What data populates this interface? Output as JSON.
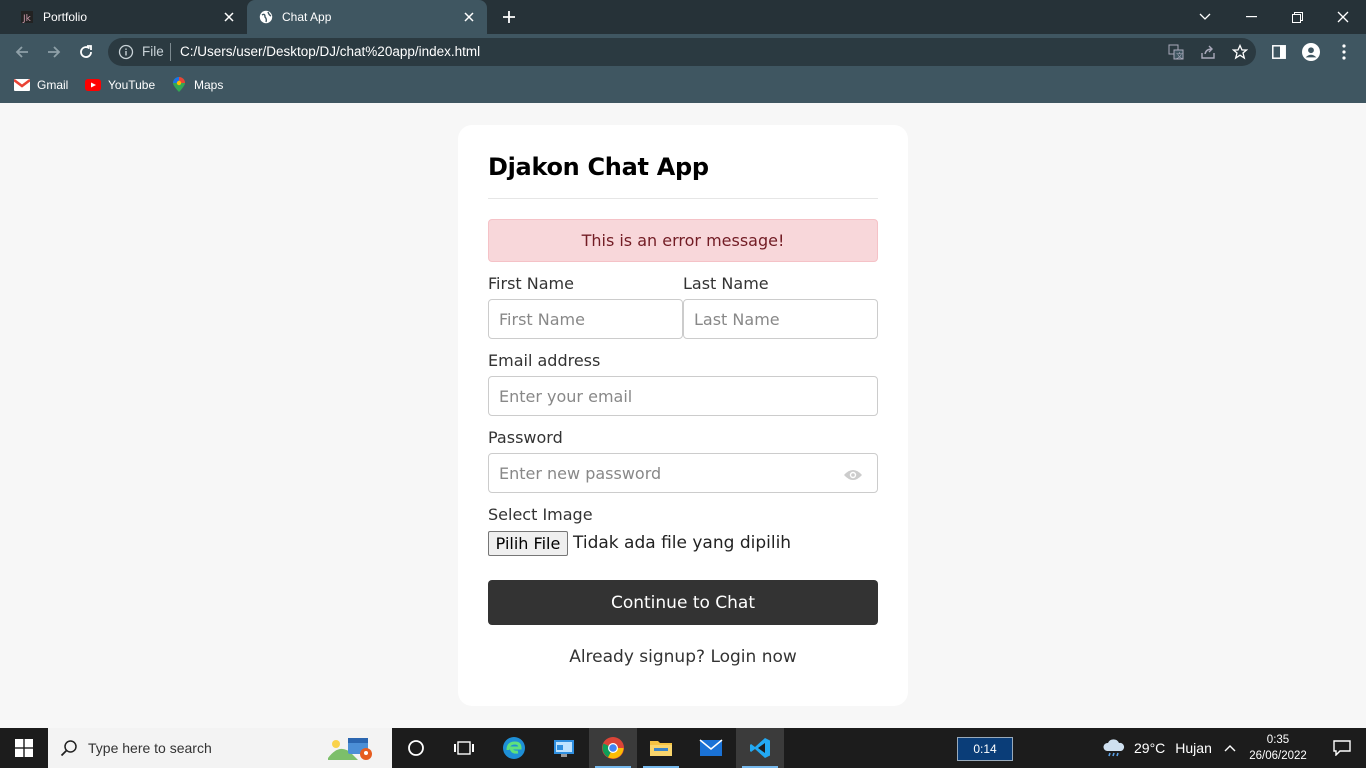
{
  "browser": {
    "tabs": [
      {
        "title": "Portfolio",
        "active": false
      },
      {
        "title": "Chat App",
        "active": true
      }
    ],
    "address": {
      "scheme_label": "File",
      "url": "C:/Users/user/Desktop/DJ/chat%20app/index.html"
    },
    "bookmarks": [
      {
        "label": "Gmail",
        "icon": "gmail-icon"
      },
      {
        "label": "YouTube",
        "icon": "youtube-icon"
      },
      {
        "label": "Maps",
        "icon": "maps-icon"
      }
    ]
  },
  "form": {
    "title": "Djakon Chat App",
    "error_message": "This is an error message!",
    "first_name": {
      "label": "First Name",
      "placeholder": "First Name"
    },
    "last_name": {
      "label": "Last Name",
      "placeholder": "Last Name"
    },
    "email": {
      "label": "Email address",
      "placeholder": "Enter your email"
    },
    "password": {
      "label": "Password",
      "placeholder": "Enter new password"
    },
    "image": {
      "label": "Select Image",
      "button": "Pilih File",
      "status": "Tidak ada file yang dipilih"
    },
    "submit_label": "Continue to Chat",
    "signup_prompt": "Already signup?",
    "login_link": "Login now"
  },
  "taskbar": {
    "search_placeholder": "Type here to search",
    "timer": "0:14",
    "weather": {
      "temp": "29°C",
      "condition": "Hujan"
    },
    "clock": {
      "time": "0:35",
      "date": "26/06/2022"
    }
  },
  "colors": {
    "tabstrip": "#263238",
    "toolbar": "#3f5661",
    "error_bg": "#f8d7da",
    "error_text": "#721c24",
    "button_bg": "#333333"
  }
}
